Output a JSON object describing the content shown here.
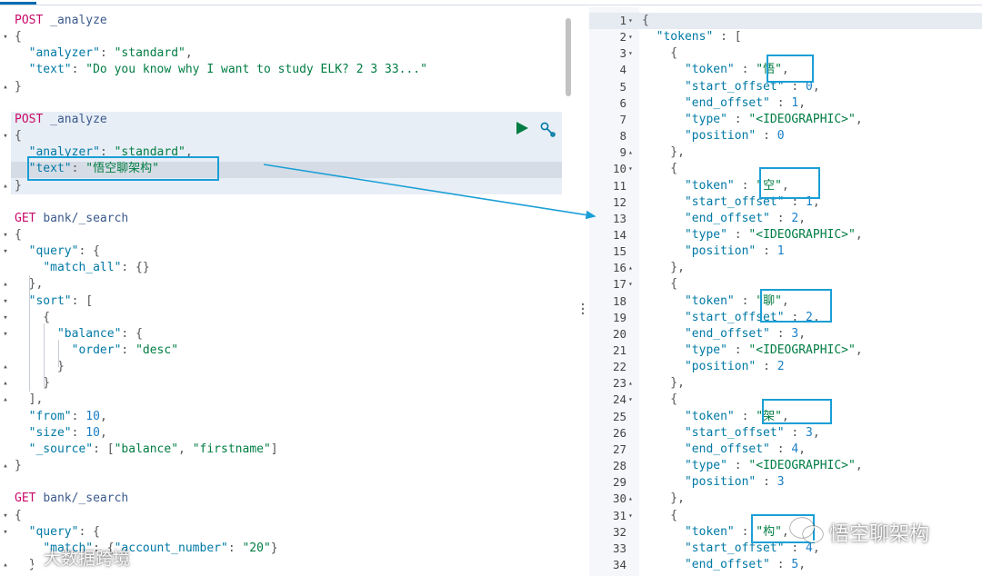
{
  "left_editor": {
    "lines": [
      {
        "fold": "",
        "tokens": [
          [
            "post",
            "POST"
          ],
          [
            "punc",
            " "
          ],
          [
            "url",
            "_analyze"
          ]
        ]
      },
      {
        "fold": "▾",
        "tokens": [
          [
            "punc",
            "{"
          ]
        ]
      },
      {
        "fold": "",
        "tokens": [
          [
            "punc",
            "  "
          ],
          [
            "key",
            "\"analyzer\""
          ],
          [
            "punc",
            ": "
          ],
          [
            "str",
            "\"standard\""
          ],
          [
            "punc",
            ","
          ]
        ]
      },
      {
        "fold": "",
        "tokens": [
          [
            "punc",
            "  "
          ],
          [
            "key",
            "\"text\""
          ],
          [
            "punc",
            ": "
          ],
          [
            "str",
            "\"Do you know why I want to study ELK? 2 3 33...\""
          ]
        ]
      },
      {
        "fold": "▴",
        "tokens": [
          [
            "punc",
            "}"
          ]
        ]
      },
      {
        "fold": "",
        "tokens": []
      },
      {
        "fold": "",
        "tokens": [
          [
            "post",
            "POST"
          ],
          [
            "punc",
            " "
          ],
          [
            "url",
            "_analyze"
          ]
        ]
      },
      {
        "fold": "▾",
        "tokens": [
          [
            "punc",
            "{"
          ]
        ]
      },
      {
        "fold": "",
        "tokens": [
          [
            "punc",
            "  "
          ],
          [
            "key",
            "\"analyzer\""
          ],
          [
            "punc",
            ": "
          ],
          [
            "str",
            "\"standard\""
          ],
          [
            "punc",
            ","
          ]
        ]
      },
      {
        "fold": "",
        "tokens": [
          [
            "punc",
            "  "
          ],
          [
            "key",
            "\"text\""
          ],
          [
            "punc",
            ": "
          ],
          [
            "str",
            "\"悟空聊架构\""
          ]
        ]
      },
      {
        "fold": "▴",
        "tokens": [
          [
            "punc",
            "}"
          ]
        ]
      },
      {
        "fold": "",
        "tokens": []
      },
      {
        "fold": "",
        "tokens": [
          [
            "post",
            "GET"
          ],
          [
            "punc",
            " "
          ],
          [
            "url",
            "bank/_search"
          ]
        ]
      },
      {
        "fold": "▾",
        "tokens": [
          [
            "punc",
            "{"
          ]
        ]
      },
      {
        "fold": "▾",
        "tokens": [
          [
            "punc",
            "  "
          ],
          [
            "key",
            "\"query\""
          ],
          [
            "punc",
            ": {"
          ]
        ]
      },
      {
        "fold": "",
        "tokens": [
          [
            "punc",
            "    "
          ],
          [
            "key",
            "\"match_all\""
          ],
          [
            "punc",
            ": {}"
          ]
        ]
      },
      {
        "fold": "▴",
        "tokens": [
          [
            "punc",
            "  },"
          ]
        ]
      },
      {
        "fold": "▾",
        "tokens": [
          [
            "punc",
            "  "
          ],
          [
            "key",
            "\"sort\""
          ],
          [
            "punc",
            ": ["
          ]
        ]
      },
      {
        "fold": "▾",
        "tokens": [
          [
            "punc",
            "    {"
          ]
        ]
      },
      {
        "fold": "▾",
        "tokens": [
          [
            "punc",
            "      "
          ],
          [
            "key",
            "\"balance\""
          ],
          [
            "punc",
            ": {"
          ]
        ]
      },
      {
        "fold": "",
        "tokens": [
          [
            "punc",
            "        "
          ],
          [
            "key",
            "\"order\""
          ],
          [
            "punc",
            ": "
          ],
          [
            "str",
            "\"desc\""
          ]
        ]
      },
      {
        "fold": "▴",
        "tokens": [
          [
            "punc",
            "      }"
          ]
        ]
      },
      {
        "fold": "▴",
        "tokens": [
          [
            "punc",
            "    }"
          ]
        ]
      },
      {
        "fold": "▴",
        "tokens": [
          [
            "punc",
            "  ],"
          ]
        ]
      },
      {
        "fold": "",
        "tokens": [
          [
            "punc",
            "  "
          ],
          [
            "key",
            "\"from\""
          ],
          [
            "punc",
            ": "
          ],
          [
            "num",
            "10"
          ],
          [
            "punc",
            ","
          ]
        ]
      },
      {
        "fold": "",
        "tokens": [
          [
            "punc",
            "  "
          ],
          [
            "key",
            "\"size\""
          ],
          [
            "punc",
            ": "
          ],
          [
            "num",
            "10"
          ],
          [
            "punc",
            ","
          ]
        ]
      },
      {
        "fold": "",
        "tokens": [
          [
            "punc",
            "  "
          ],
          [
            "key",
            "\"_source\""
          ],
          [
            "punc",
            ": ["
          ],
          [
            "str",
            "\"balance\""
          ],
          [
            "punc",
            ", "
          ],
          [
            "str",
            "\"firstname\""
          ],
          [
            "punc",
            "]"
          ]
        ]
      },
      {
        "fold": "▴",
        "tokens": [
          [
            "punc",
            "}"
          ]
        ]
      },
      {
        "fold": "",
        "tokens": []
      },
      {
        "fold": "",
        "tokens": [
          [
            "post",
            "GET"
          ],
          [
            "punc",
            " "
          ],
          [
            "url",
            "bank/_search"
          ]
        ]
      },
      {
        "fold": "▾",
        "tokens": [
          [
            "punc",
            "{"
          ]
        ]
      },
      {
        "fold": "▾",
        "tokens": [
          [
            "punc",
            "  "
          ],
          [
            "key",
            "\"query\""
          ],
          [
            "punc",
            ": {"
          ]
        ]
      },
      {
        "fold": "",
        "tokens": [
          [
            "punc",
            "    "
          ],
          [
            "key",
            "\"match\""
          ],
          [
            "punc",
            ": {"
          ],
          [
            "key",
            "\"account_number\""
          ],
          [
            "punc",
            ": "
          ],
          [
            "str",
            "\"20\""
          ],
          [
            "punc",
            "}"
          ]
        ]
      },
      {
        "fold": "▴",
        "tokens": [
          [
            "punc",
            "  }"
          ]
        ]
      }
    ]
  },
  "right_output": {
    "lines": [
      {
        "n": "1",
        "fold": "▾",
        "tokens": [
          [
            "punc",
            "{"
          ]
        ]
      },
      {
        "n": "2",
        "fold": "▾",
        "tokens": [
          [
            "punc",
            "  "
          ],
          [
            "key",
            "\"tokens\""
          ],
          [
            "punc",
            " : ["
          ]
        ]
      },
      {
        "n": "3",
        "fold": "▾",
        "tokens": [
          [
            "punc",
            "    {"
          ]
        ]
      },
      {
        "n": "4",
        "fold": "",
        "tokens": [
          [
            "punc",
            "      "
          ],
          [
            "key",
            "\"token\""
          ],
          [
            "punc",
            " : "
          ],
          [
            "str",
            "\"悟\""
          ],
          [
            "punc",
            ","
          ]
        ]
      },
      {
        "n": "5",
        "fold": "",
        "tokens": [
          [
            "punc",
            "      "
          ],
          [
            "key",
            "\"start_offset\""
          ],
          [
            "punc",
            " : "
          ],
          [
            "num",
            "0"
          ],
          [
            "punc",
            ","
          ]
        ]
      },
      {
        "n": "6",
        "fold": "",
        "tokens": [
          [
            "punc",
            "      "
          ],
          [
            "key",
            "\"end_offset\""
          ],
          [
            "punc",
            " : "
          ],
          [
            "num",
            "1"
          ],
          [
            "punc",
            ","
          ]
        ]
      },
      {
        "n": "7",
        "fold": "",
        "tokens": [
          [
            "punc",
            "      "
          ],
          [
            "key",
            "\"type\""
          ],
          [
            "punc",
            " : "
          ],
          [
            "str",
            "\"<IDEOGRAPHIC>\""
          ],
          [
            "punc",
            ","
          ]
        ]
      },
      {
        "n": "8",
        "fold": "",
        "tokens": [
          [
            "punc",
            "      "
          ],
          [
            "key",
            "\"position\""
          ],
          [
            "punc",
            " : "
          ],
          [
            "num",
            "0"
          ]
        ]
      },
      {
        "n": "9",
        "fold": "▴",
        "tokens": [
          [
            "punc",
            "    },"
          ]
        ]
      },
      {
        "n": "10",
        "fold": "▾",
        "tokens": [
          [
            "punc",
            "    {"
          ]
        ]
      },
      {
        "n": "11",
        "fold": "",
        "tokens": [
          [
            "punc",
            "      "
          ],
          [
            "key",
            "\"token\""
          ],
          [
            "punc",
            " : "
          ],
          [
            "str",
            "\"空\""
          ],
          [
            "punc",
            ","
          ]
        ]
      },
      {
        "n": "12",
        "fold": "",
        "tokens": [
          [
            "punc",
            "      "
          ],
          [
            "key",
            "\"start_offset\""
          ],
          [
            "punc",
            " : "
          ],
          [
            "num",
            "1"
          ],
          [
            "punc",
            ","
          ]
        ]
      },
      {
        "n": "13",
        "fold": "",
        "tokens": [
          [
            "punc",
            "      "
          ],
          [
            "key",
            "\"end_offset\""
          ],
          [
            "punc",
            " : "
          ],
          [
            "num",
            "2"
          ],
          [
            "punc",
            ","
          ]
        ]
      },
      {
        "n": "14",
        "fold": "",
        "tokens": [
          [
            "punc",
            "      "
          ],
          [
            "key",
            "\"type\""
          ],
          [
            "punc",
            " : "
          ],
          [
            "str",
            "\"<IDEOGRAPHIC>\""
          ],
          [
            "punc",
            ","
          ]
        ]
      },
      {
        "n": "15",
        "fold": "",
        "tokens": [
          [
            "punc",
            "      "
          ],
          [
            "key",
            "\"position\""
          ],
          [
            "punc",
            " : "
          ],
          [
            "num",
            "1"
          ]
        ]
      },
      {
        "n": "16",
        "fold": "▴",
        "tokens": [
          [
            "punc",
            "    },"
          ]
        ]
      },
      {
        "n": "17",
        "fold": "▾",
        "tokens": [
          [
            "punc",
            "    {"
          ]
        ]
      },
      {
        "n": "18",
        "fold": "",
        "tokens": [
          [
            "punc",
            "      "
          ],
          [
            "key",
            "\"token\""
          ],
          [
            "punc",
            " : "
          ],
          [
            "str",
            "\"聊\""
          ],
          [
            "punc",
            ","
          ]
        ]
      },
      {
        "n": "19",
        "fold": "",
        "tokens": [
          [
            "punc",
            "      "
          ],
          [
            "key",
            "\"start_offset\""
          ],
          [
            "punc",
            " : "
          ],
          [
            "num",
            "2"
          ],
          [
            "punc",
            ","
          ]
        ]
      },
      {
        "n": "20",
        "fold": "",
        "tokens": [
          [
            "punc",
            "      "
          ],
          [
            "key",
            "\"end_offset\""
          ],
          [
            "punc",
            " : "
          ],
          [
            "num",
            "3"
          ],
          [
            "punc",
            ","
          ]
        ]
      },
      {
        "n": "21",
        "fold": "",
        "tokens": [
          [
            "punc",
            "      "
          ],
          [
            "key",
            "\"type\""
          ],
          [
            "punc",
            " : "
          ],
          [
            "str",
            "\"<IDEOGRAPHIC>\""
          ],
          [
            "punc",
            ","
          ]
        ]
      },
      {
        "n": "22",
        "fold": "",
        "tokens": [
          [
            "punc",
            "      "
          ],
          [
            "key",
            "\"position\""
          ],
          [
            "punc",
            " : "
          ],
          [
            "num",
            "2"
          ]
        ]
      },
      {
        "n": "23",
        "fold": "▴",
        "tokens": [
          [
            "punc",
            "    },"
          ]
        ]
      },
      {
        "n": "24",
        "fold": "▾",
        "tokens": [
          [
            "punc",
            "    {"
          ]
        ]
      },
      {
        "n": "25",
        "fold": "",
        "tokens": [
          [
            "punc",
            "      "
          ],
          [
            "key",
            "\"token\""
          ],
          [
            "punc",
            " : "
          ],
          [
            "str",
            "\"架\""
          ],
          [
            "punc",
            ","
          ]
        ]
      },
      {
        "n": "26",
        "fold": "",
        "tokens": [
          [
            "punc",
            "      "
          ],
          [
            "key",
            "\"start_offset\""
          ],
          [
            "punc",
            " : "
          ],
          [
            "num",
            "3"
          ],
          [
            "punc",
            ","
          ]
        ]
      },
      {
        "n": "27",
        "fold": "",
        "tokens": [
          [
            "punc",
            "      "
          ],
          [
            "key",
            "\"end_offset\""
          ],
          [
            "punc",
            " : "
          ],
          [
            "num",
            "4"
          ],
          [
            "punc",
            ","
          ]
        ]
      },
      {
        "n": "28",
        "fold": "",
        "tokens": [
          [
            "punc",
            "      "
          ],
          [
            "key",
            "\"type\""
          ],
          [
            "punc",
            " : "
          ],
          [
            "str",
            "\"<IDEOGRAPHIC>\""
          ],
          [
            "punc",
            ","
          ]
        ]
      },
      {
        "n": "29",
        "fold": "",
        "tokens": [
          [
            "punc",
            "      "
          ],
          [
            "key",
            "\"position\""
          ],
          [
            "punc",
            " : "
          ],
          [
            "num",
            "3"
          ]
        ]
      },
      {
        "n": "30",
        "fold": "▴",
        "tokens": [
          [
            "punc",
            "    },"
          ]
        ]
      },
      {
        "n": "31",
        "fold": "▾",
        "tokens": [
          [
            "punc",
            "    {"
          ]
        ]
      },
      {
        "n": "32",
        "fold": "",
        "tokens": [
          [
            "punc",
            "      "
          ],
          [
            "key",
            "\"token\""
          ],
          [
            "punc",
            " : "
          ],
          [
            "str",
            "\"构\""
          ],
          [
            "punc",
            ","
          ]
        ]
      },
      {
        "n": "33",
        "fold": "",
        "tokens": [
          [
            "punc",
            "      "
          ],
          [
            "key",
            "\"start_offset\""
          ],
          [
            "punc",
            " : "
          ],
          [
            "num",
            "4"
          ],
          [
            "punc",
            ","
          ]
        ]
      },
      {
        "n": "34",
        "fold": "",
        "tokens": [
          [
            "punc",
            "      "
          ],
          [
            "key",
            "\"end_offset\""
          ],
          [
            "punc",
            " : "
          ],
          [
            "num",
            "5"
          ],
          [
            "punc",
            ","
          ]
        ]
      }
    ]
  },
  "watermarks": {
    "right": "悟空聊架构",
    "left": "大数据跨境"
  },
  "colors": {
    "annotation_box": "#1a9fd6",
    "run_button": "#017d43",
    "method": "#c80a68",
    "key": "#0079a5",
    "string": "#017d43"
  },
  "icons": {
    "run": "play-icon",
    "settings": "wrench-icon",
    "divider": "vertical-ellipsis-icon"
  }
}
